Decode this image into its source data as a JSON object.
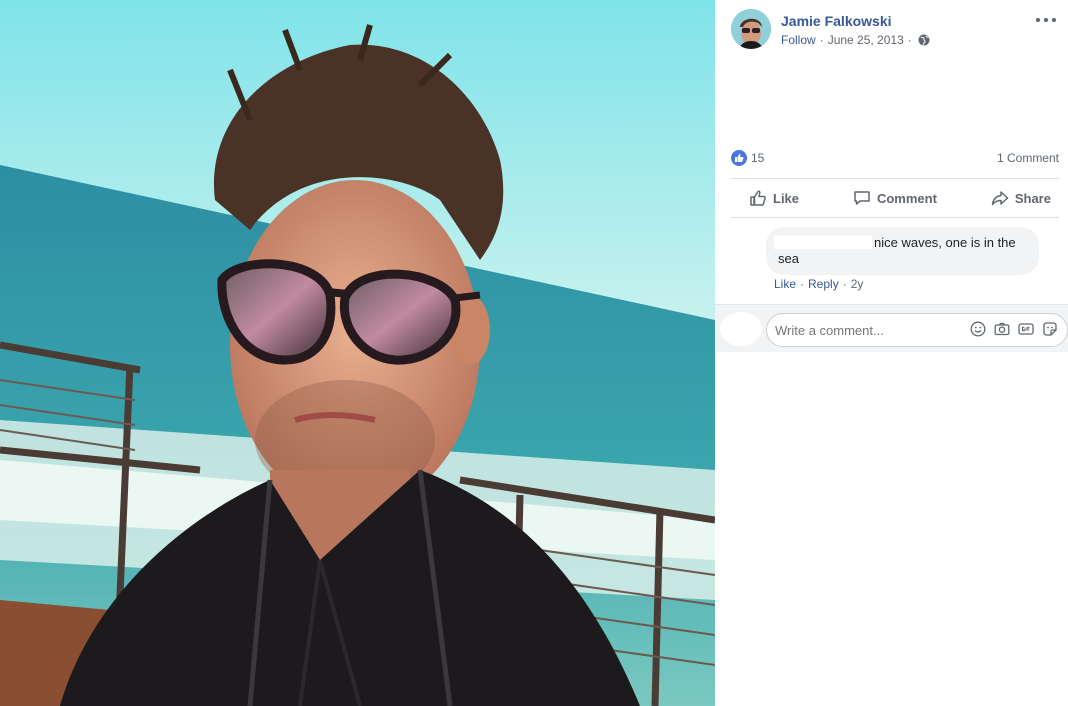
{
  "post": {
    "author": "Jamie Falkowski",
    "follow_label": "Follow",
    "date": "June 25, 2013",
    "privacy_icon": "globe-icon",
    "more_icon": "more-options-icon"
  },
  "reactions": {
    "like_count": "15",
    "comment_count": "1 Comment"
  },
  "actions": {
    "like": "Like",
    "comment": "Comment",
    "share": "Share"
  },
  "comment": {
    "text": "nice waves, one is in the sea",
    "like_label": "Like",
    "reply_label": "Reply",
    "age": "2y"
  },
  "composer": {
    "placeholder": "Write a comment...",
    "icons": [
      "emoji-icon",
      "camera-icon",
      "gif-icon",
      "sticker-icon"
    ]
  },
  "colors": {
    "link_blue": "#385898",
    "like_blue": "#4a76e8",
    "muted_text": "#606770",
    "bubble_bg": "#f2f3f5"
  }
}
